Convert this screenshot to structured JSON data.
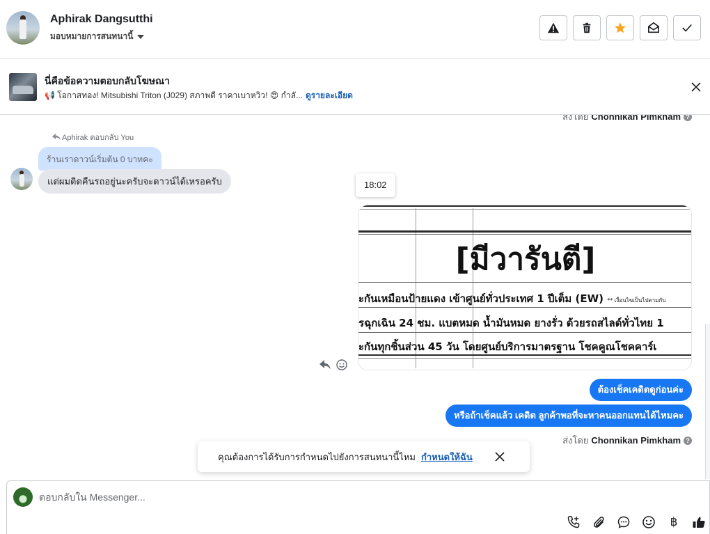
{
  "header": {
    "contact_name": "Aphirak Dangsutthi",
    "assign_label": "มอบหมายการสนทนานี้",
    "actions": [
      {
        "name": "warning",
        "icon": "warning-icon"
      },
      {
        "name": "delete",
        "icon": "trash-icon"
      },
      {
        "name": "star",
        "icon": "star-icon"
      },
      {
        "name": "mark-unread",
        "icon": "envelope-open-icon"
      },
      {
        "name": "done",
        "icon": "check-icon"
      }
    ],
    "star_color": "#f5a623"
  },
  "ad": {
    "title": "นี่คือข้อความตอบกลับโฆษณา",
    "text": "📢 โอกาสทอง! Mitsubishi Triton (J029) สภาพดี ราคาเบาหวิว! 😍 กำลั...",
    "link": "ดูรายละเอียด"
  },
  "conversation": {
    "sent_by_top": {
      "prefix": "ส่งโดย",
      "name": "Chonnikan Pimkham"
    },
    "reply_note": "Aphirak ตอบกลับ You",
    "quoted": "ร้านเราดาวน์เริ่มต้น 0 บาทคะ",
    "incoming": "แต่ผมติดคืนรถอยู่นะครับจะดาวน์ได้เหรอครับ",
    "time": "18:02",
    "image": {
      "heading": "[มีวารันตี]",
      "lines": [
        "ะกันเหมือนป้ายแดง เข้าศูนย์ทั่วประเทศ 1 ปีเต็ม (EW)",
        "รฉุกเฉิน 24 ชม. แบตหมด น้ำมันหมด ยางรั่ว ด้วยรถสไลด์ทั่วไทย 1",
        "ะกันทุกชิ้นส่วน 45 วัน โดยศูนย์บริการมาตรฐาน โชคคูณโชคคาร์เ"
      ],
      "small_note": "** เงื่อนไขเป็นไปตามกับ"
    },
    "outgoing": [
      "ต้องเช็คเคดิตดูก่อนค่ะ",
      "หรือถ้าเช็คแล้ว เคดิต ลูกค้าพอที่จะหาคนออกแทนได้ไหมคะ"
    ],
    "sent_by_bottom": {
      "prefix": "ส่งโดย",
      "name": "Chonnikan Pimkham"
    },
    "accent": "#1877f2"
  },
  "toast": {
    "text": "คุณต้องการได้รับการกำหนดไปยังการสนทนานี้ไหม",
    "link": "กำหนดให้ฉัน"
  },
  "composer": {
    "placeholder": "ตอบกลับใน Messenger...",
    "tools": [
      "call-add-icon",
      "paperclip-icon",
      "chat-bubble-icon",
      "emoji-icon",
      "baht-icon",
      "thumbs-up-icon"
    ],
    "baht_symbol": "฿"
  }
}
